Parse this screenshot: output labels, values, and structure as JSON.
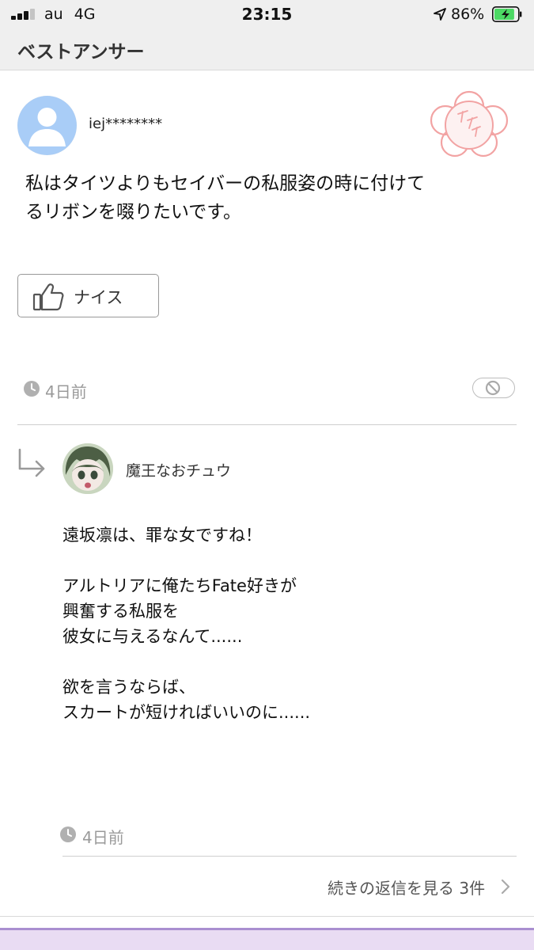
{
  "status_bar": {
    "carrier": "au",
    "network": "4G",
    "time": "23:15",
    "battery_percent": "86%",
    "battery_level": 0.86,
    "charging": true,
    "signal_bars": 3
  },
  "header": {
    "title": "ベストアンサー"
  },
  "best_answer": {
    "username": "iej********",
    "badge_icon": "best-answer-sakura-stamp",
    "body_lines": [
      "私はタイツよりもセイバーの私服姿の時に付けて",
      "るリボンを啜りたいです。"
    ],
    "nice_button_label": "ナイス",
    "posted_ago": "4日前"
  },
  "reply": {
    "username": "魔王なおチュウ",
    "body_lines": [
      "遠坂凛は、罪な女ですね！",
      "",
      "アルトリアに俺たちFate好きが",
      "興奮する私服を",
      "彼女に与えるなんて......",
      "",
      "欲を言うならば、",
      "スカートが短ければいいのに......"
    ],
    "posted_ago": "4日前",
    "more_replies_label": "続きの返信を見る",
    "more_replies_count": "3件"
  },
  "colors": {
    "header_bg": "#efefef",
    "meta_gray": "#9a9a9a",
    "battery_green": "#4cd964",
    "badge_pink": "#f2a3a3",
    "bottom_purple": "#a98fd0"
  }
}
